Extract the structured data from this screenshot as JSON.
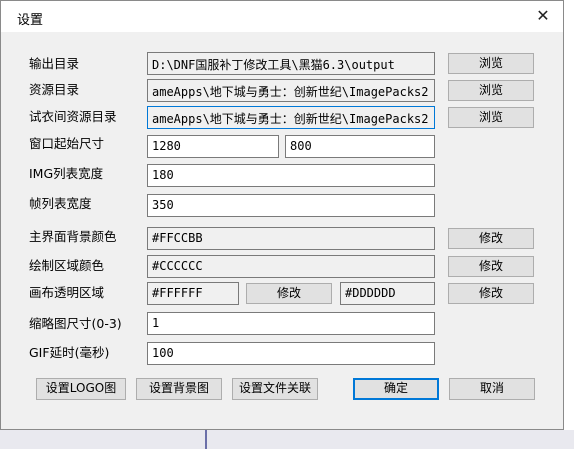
{
  "window": {
    "title": "设置",
    "close_glyph": "✕"
  },
  "rows": {
    "output_dir": {
      "label": "输出目录",
      "value": "D:\\DNF国服补丁修改工具\\黑猫6.3\\output",
      "button": "浏览"
    },
    "resource_dir": {
      "label": "资源目录",
      "value": "ameApps\\地下城与勇士：创新世纪\\ImagePacks2",
      "button": "浏览"
    },
    "fitting_dir": {
      "label": "试衣间资源目录",
      "value": "ameApps\\地下城与勇士：创新世纪\\ImagePacks2",
      "button": "浏览"
    },
    "window_size": {
      "label": "窗口起始尺寸",
      "width": "1280",
      "height": "800"
    },
    "img_list_width": {
      "label": "IMG列表宽度",
      "value": "180"
    },
    "frame_list_width": {
      "label": "帧列表宽度",
      "value": "350"
    },
    "main_bg_color": {
      "label": "主界面背景颜色",
      "value": "#FFCCBB",
      "button": "修改"
    },
    "draw_area_color": {
      "label": "绘制区域颜色",
      "value": "#CCCCCC",
      "button": "修改"
    },
    "canvas_transparent": {
      "label": "画布透明区域",
      "value1": "#FFFFFF",
      "button1": "修改",
      "value2": "#DDDDDD",
      "button2": "修改"
    },
    "thumb_size": {
      "label": "缩略图尺寸(0-3)",
      "value": "1"
    },
    "gif_delay": {
      "label": "GIF延时(毫秒)",
      "value": "100"
    }
  },
  "footer": {
    "set_logo": "设置LOGO图",
    "set_background": "设置背景图",
    "set_file_assoc": "设置文件关联",
    "ok": "确定",
    "cancel": "取消"
  },
  "colors": {
    "accent": "#0078d7",
    "button_face": "#e1e1e1",
    "dialog_bg": "#f0f0f0"
  }
}
